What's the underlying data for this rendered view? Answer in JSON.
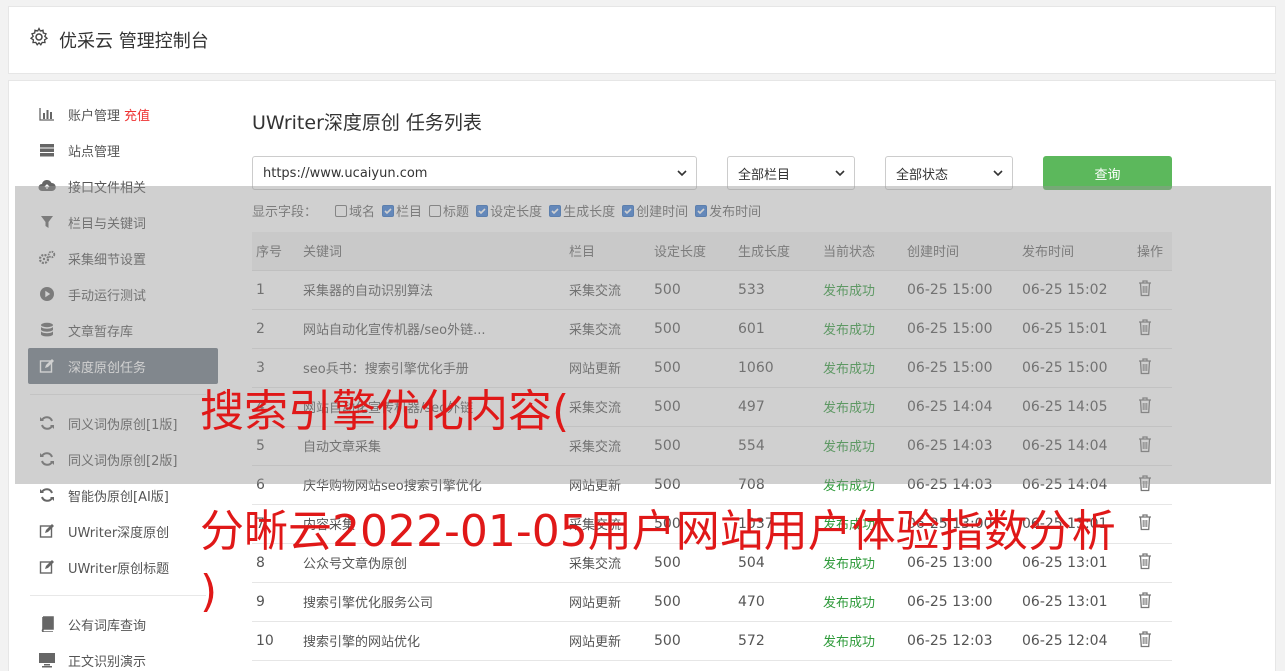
{
  "header": {
    "title": "优采云 管理控制台"
  },
  "sidebar": {
    "items": [
      {
        "label": "账户管理",
        "extra": "充值",
        "icon": "bar-chart-icon"
      },
      {
        "label": "站点管理",
        "icon": "server-icon"
      },
      {
        "label": "接口文件相关",
        "icon": "cloud-upload-icon"
      },
      {
        "label": "栏目与关键词",
        "icon": "filter-icon"
      },
      {
        "label": "采集细节设置",
        "icon": "gears-icon"
      },
      {
        "label": "手动运行测试",
        "icon": "play-circle-icon"
      },
      {
        "label": "文章暂存库",
        "icon": "database-icon"
      },
      {
        "label": "深度原创任务",
        "icon": "edit-icon",
        "active": true
      },
      {
        "label": "同义词伪原创[1版]",
        "icon": "refresh-icon"
      },
      {
        "label": "同义词伪原创[2版]",
        "icon": "refresh-icon"
      },
      {
        "label": "智能伪原创[AI版]",
        "icon": "refresh-icon"
      },
      {
        "label": "UWriter深度原创",
        "icon": "edit-icon"
      },
      {
        "label": "UWriter原创标题",
        "icon": "edit-icon"
      },
      {
        "label": "公有词库查询",
        "icon": "book-icon"
      },
      {
        "label": "正文识别演示",
        "icon": "monitor-icon"
      }
    ]
  },
  "main": {
    "title": "UWriter深度原创 任务列表",
    "site_select": "https://www.ucaiyun.com",
    "column_select": "全部栏目",
    "status_select": "全部状态",
    "query_button": "查询",
    "fields_label": "显示字段：",
    "fields": [
      {
        "label": "域名",
        "checked": false
      },
      {
        "label": "栏目",
        "checked": true
      },
      {
        "label": "标题",
        "checked": false
      },
      {
        "label": "设定长度",
        "checked": true
      },
      {
        "label": "生成长度",
        "checked": true
      },
      {
        "label": "创建时间",
        "checked": true
      },
      {
        "label": "发布时间",
        "checked": true
      }
    ],
    "columns": [
      "序号",
      "关键词",
      "栏目",
      "设定长度",
      "生成长度",
      "当前状态",
      "创建时间",
      "发布时间",
      "操作"
    ],
    "rows": [
      [
        "1",
        "采集器的自动识别算法",
        "采集交流",
        "500",
        "533",
        "发布成功",
        "06-25 15:00",
        "06-25 15:02"
      ],
      [
        "2",
        "网站自动化宣传机器/seo外链...",
        "采集交流",
        "500",
        "601",
        "发布成功",
        "06-25 15:00",
        "06-25 15:01"
      ],
      [
        "3",
        "seo兵书：搜索引擎优化手册",
        "网站更新",
        "500",
        "1060",
        "发布成功",
        "06-25 15:00",
        "06-25 15:00"
      ],
      [
        "4",
        "网站自动化宣传机器/seo外链",
        "采集交流",
        "500",
        "497",
        "发布成功",
        "06-25 14:04",
        "06-25 14:05"
      ],
      [
        "5",
        "自动文章采集",
        "采集交流",
        "500",
        "554",
        "发布成功",
        "06-25 14:03",
        "06-25 14:04"
      ],
      [
        "6",
        "庆华购物网站seo搜索引擎优化",
        "网站更新",
        "500",
        "708",
        "发布成功",
        "06-25 14:03",
        "06-25 14:04"
      ],
      [
        "7",
        "内容采集",
        "采集交流",
        "500",
        "1037",
        "发布成功",
        "06-25 13:00",
        "06-25 13:01"
      ],
      [
        "8",
        "公众号文章伪原创",
        "采集交流",
        "500",
        "504",
        "发布成功",
        "06-25 13:00",
        "06-25 13:01"
      ],
      [
        "9",
        "搜索引擎优化服务公司",
        "网站更新",
        "500",
        "470",
        "发布成功",
        "06-25 13:00",
        "06-25 13:01"
      ],
      [
        "10",
        "搜索引擎的网站优化",
        "网站更新",
        "500",
        "572",
        "发布成功",
        "06-25 12:03",
        "06-25 12:04"
      ]
    ]
  },
  "overlay": {
    "line1": "搜索引擎优化内容(",
    "line2": "分晰云2022-01-05用户网站用户体验指数分析",
    "line3": ")",
    "color": "#e01818"
  }
}
